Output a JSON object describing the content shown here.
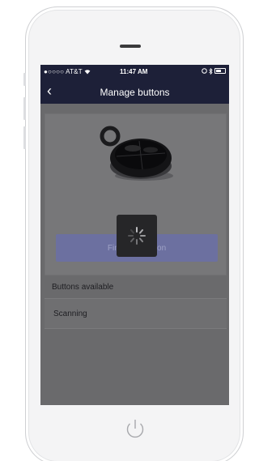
{
  "status_bar": {
    "carrier": "●○○○○ AT&T",
    "wifi_icon": "wifi-icon",
    "time": "11:47 AM",
    "bluetooth_icon": "bluetooth-icon",
    "battery_icon": "battery-icon"
  },
  "nav": {
    "back_icon": "chevron-left-icon",
    "back_glyph": "‹",
    "title": "Manage buttons"
  },
  "main": {
    "find_button_label": "Find your button",
    "section_header": "Buttons available",
    "list_items": [
      {
        "label": "Scanning"
      }
    ]
  },
  "overlay": {
    "spinner_icon": "loading-spinner-icon"
  },
  "colors": {
    "nav_background": "#1d2038",
    "find_button": "#6c70a0",
    "screen_dimmed": "#6a6a6c",
    "spinner_background": "#262628"
  }
}
